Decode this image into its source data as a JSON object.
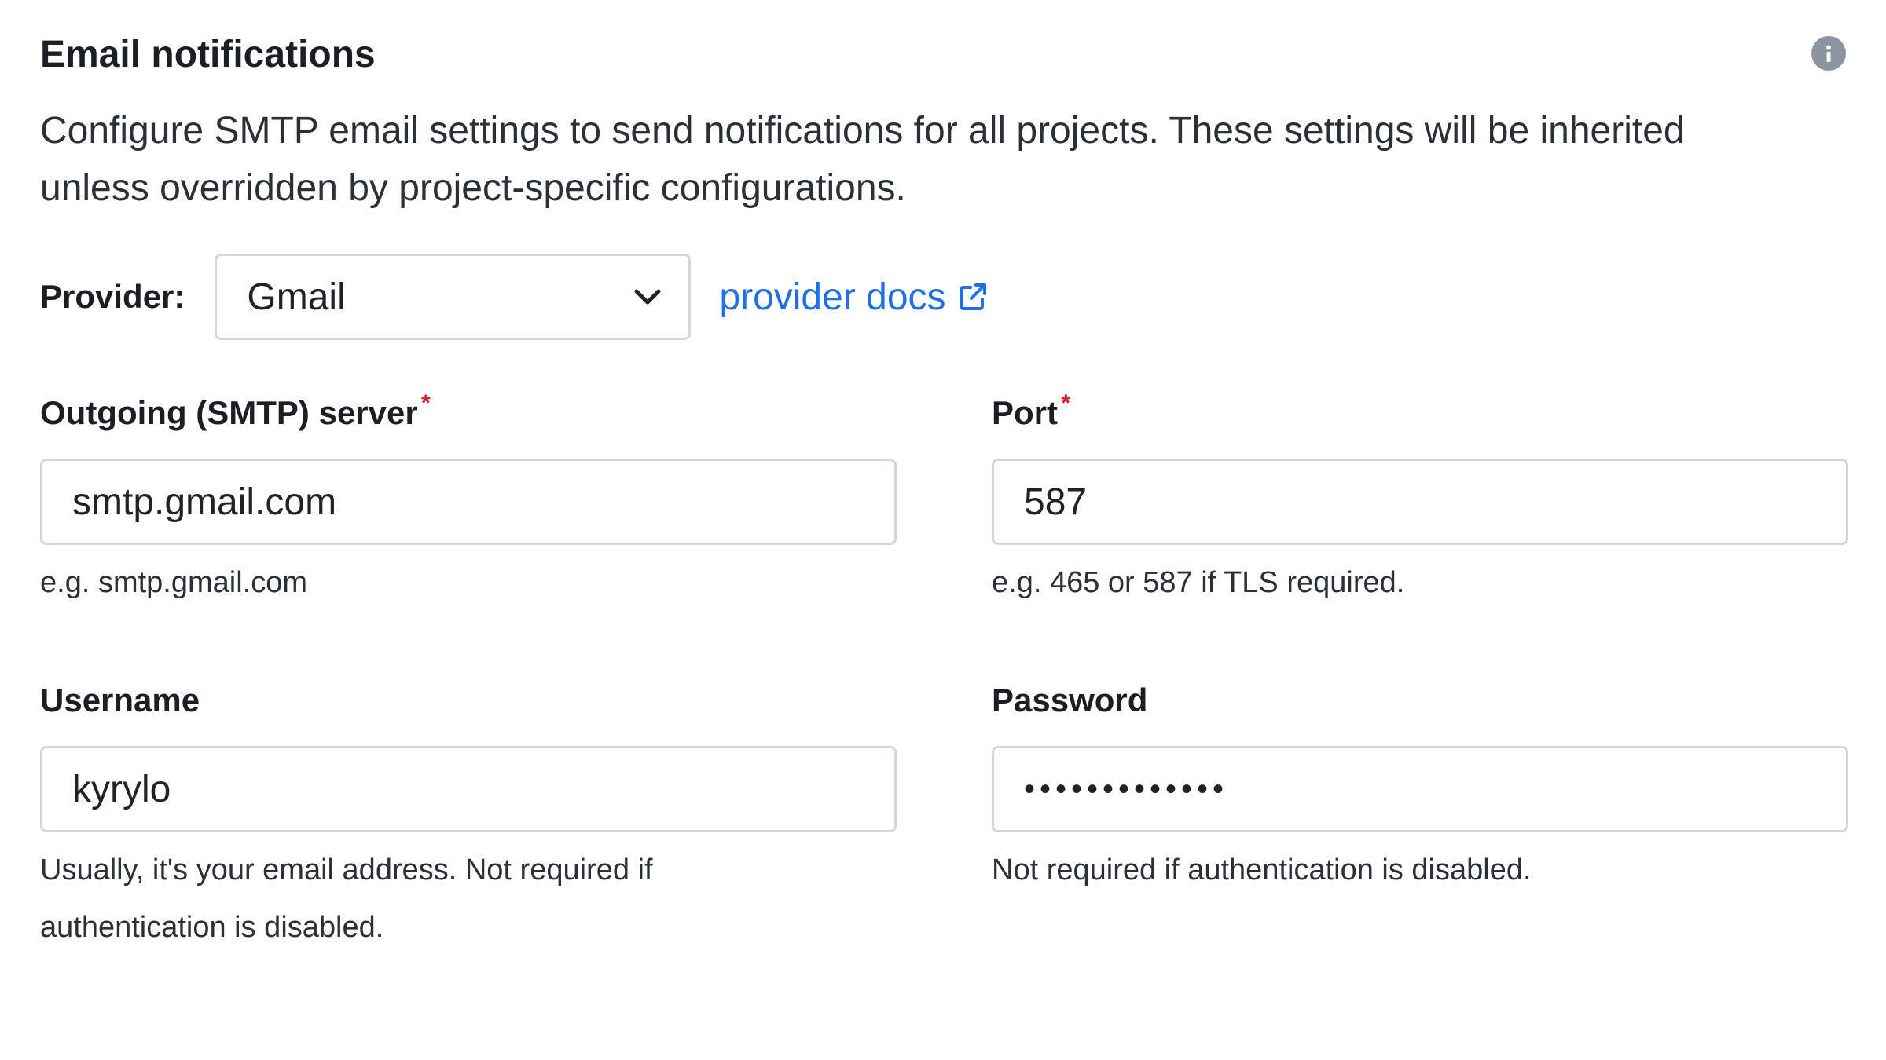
{
  "section": {
    "title": "Email notifications",
    "info_icon": "info-icon",
    "description": "Configure SMTP email settings to send notifications for all projects. These settings will be inherited unless overridden by project-specific configurations."
  },
  "provider": {
    "label": "Provider:",
    "selected": "Gmail",
    "docs_link": "provider docs",
    "docs_icon": "external-link-icon"
  },
  "fields": {
    "smtp_server": {
      "label": "Outgoing (SMTP) server",
      "required_mark": "*",
      "value": "smtp.gmail.com",
      "help": "e.g. smtp.gmail.com"
    },
    "port": {
      "label": "Port",
      "required_mark": "*",
      "value": "587",
      "help": "e.g. 465 or 587 if TLS required."
    },
    "username": {
      "label": "Username",
      "value": "kyrylo",
      "help": "Usually, it's your email address. Not required if authentication is disabled."
    },
    "password": {
      "label": "Password",
      "value": "•••••••••••••",
      "help": "Not required if authentication is disabled."
    }
  },
  "colors": {
    "link": "#1f6feb",
    "required": "#cf222e",
    "border": "#d0d7de",
    "icon_gray": "#8c959f"
  }
}
